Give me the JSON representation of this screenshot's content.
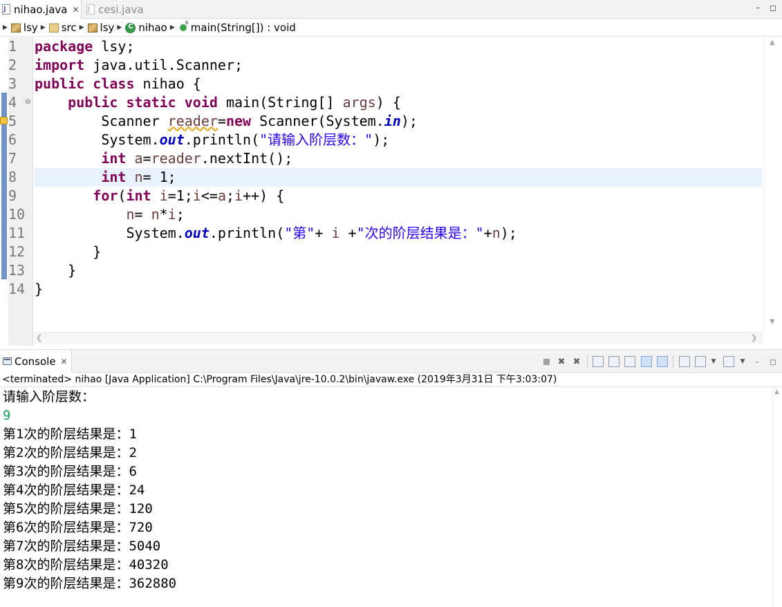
{
  "editor_tabs": [
    {
      "label": "nihao.java",
      "close": "✕"
    },
    {
      "label": "cesi.java"
    }
  ],
  "window_buttons": {
    "minimize": "–",
    "maximize": "◻"
  },
  "breadcrumb": [
    "lsy",
    "src",
    "lsy",
    "nihao",
    "main(String[]) : void"
  ],
  "line_numbers": [
    "1",
    "2",
    "3",
    "4",
    "5",
    "6",
    "7",
    "8",
    "9",
    "10",
    "11",
    "12",
    "13",
    "14"
  ],
  "code": {
    "l1_kw": "package",
    "l1_rest": " lsy;",
    "l2_kw": "import",
    "l2_rest": " java.util.Scanner;",
    "l3_kw1": "public",
    "l3_kw2": "class",
    "l3_rest": " nihao {",
    "l4_indent": "    ",
    "l4_kw1": "public",
    "l4_kw2": "static",
    "l4_kw3": "void",
    "l4_mid": " main(String[] ",
    "l4_var": "args",
    "l4_end": ") {",
    "l5_indent": "        Scanner ",
    "l5_var": "reader",
    "l5_eq": "=",
    "l5_kw": "new",
    "l5_mid": " Scanner(System.",
    "l5_fld": "in",
    "l5_end": ");",
    "l6_indent": "        System.",
    "l6_fld": "out",
    "l6_mid": ".println(",
    "l6_str": "\"请输入阶层数：\"",
    "l6_end": ");",
    "l7_indent": "        ",
    "l7_kw": "int",
    "l7_sp": " ",
    "l7_var": "a",
    "l7_mid": "=",
    "l7_var2": "reader",
    "l7_end": ".nextInt();",
    "l8_indent": "        ",
    "l8_kw": "int",
    "l8_sp": " ",
    "l8_var": "n",
    "l8_end": "= 1;",
    "l9_indent": "       ",
    "l9_kw": "for",
    "l9_p": "(",
    "l9_kw2": "int",
    "l9_sp": " ",
    "l9_v1": "i",
    "l9_t1": "=1;",
    "l9_v2": "i",
    "l9_t2": "<=",
    "l9_v3": "a",
    "l9_t3": ";",
    "l9_v4": "i",
    "l9_end": "++) {",
    "l10_indent": "           ",
    "l10_v1": "n",
    "l10_mid": "= ",
    "l10_v2": "n",
    "l10_op": "*",
    "l10_v3": "i",
    "l10_end": ";",
    "l11_indent": "           System.",
    "l11_fld": "out",
    "l11_mid": ".println(",
    "l11_s1": "\"第\"",
    "l11_p1": "+ ",
    "l11_v1": "i",
    "l11_p2": " +",
    "l11_s2": "\"次的阶层结果是：\"",
    "l11_p3": "+",
    "l11_v2": "n",
    "l11_end": ");",
    "l12": "       }",
    "l13": "    }",
    "l14": "}"
  },
  "console": {
    "tab_label": "Console",
    "tab_close": "✕",
    "status": "<terminated> nihao [Java Application] C:\\Program Files\\Java\\jre-10.0.2\\bin\\javaw.exe (2019年3月31日 下午3:03:07)",
    "output": [
      "请输入阶层数：",
      "9",
      "第1次的阶层结果是：1",
      "第2次的阶层结果是：2",
      "第3次的阶层结果是：6",
      "第4次的阶层结果是：24",
      "第5次的阶层结果是：120",
      "第6次的阶层结果是：720",
      "第7次的阶层结果是：5040",
      "第8次的阶层结果是：40320",
      "第9次的阶层结果是：362880"
    ]
  },
  "colors": {
    "keyword": "#7f0055",
    "string": "#2a00ff",
    "field": "#0000c0",
    "local_variable": "#6a3e3e",
    "console_input": "#17a05a",
    "current_line": "#e8f2fe"
  }
}
